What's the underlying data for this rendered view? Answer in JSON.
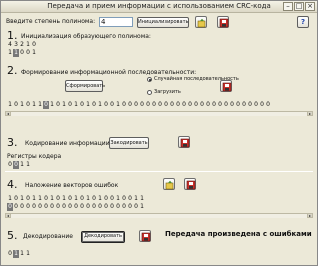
{
  "window": {
    "title": "Передача и прием информации с использованием CRC-кода"
  },
  "polynomial": {
    "label": "Введите степень полинома:",
    "value": "4",
    "init_button": "Инициализировать",
    "help_button": "?"
  },
  "section1": {
    "number": "1.",
    "title": "Инициализация образующего полинома:",
    "exponents": [
      "4",
      "3",
      "2",
      "1",
      "0"
    ],
    "coefficients": [
      "1",
      "1",
      "0",
      "0",
      "1"
    ],
    "selected_index": 1
  },
  "section2": {
    "number": "2.",
    "title": "Формирование информационной последовательности:",
    "generate_button": "Сформировать",
    "radio_random": "Случайная последовательность",
    "radio_load": "Загрузить",
    "bits": [
      "1",
      "0",
      "1",
      "0",
      "1",
      "1",
      "0",
      "1",
      "0",
      "1",
      "0",
      "1",
      "0",
      "1",
      "0",
      "1",
      "0",
      "0",
      "1",
      "0",
      "0",
      "0",
      "0",
      "0",
      "0",
      "0",
      "0",
      "0",
      "0",
      "0",
      "0",
      "0",
      "0",
      "0",
      "0",
      "0",
      "0",
      "0",
      "0",
      "0",
      "0",
      "0",
      "0",
      "0"
    ],
    "selected_index": 6
  },
  "section3": {
    "number": "3.",
    "title": "Кодирование информации",
    "encode_button": "Закодировать",
    "registers_label": "Регистры кодера",
    "registers": [
      "0",
      "0",
      "1",
      "1"
    ],
    "selected_index": 1
  },
  "section4": {
    "number": "4.",
    "title": "Наложение векторов ошибок",
    "row1": [
      "1",
      "0",
      "1",
      "0",
      "1",
      "1",
      "0",
      "1",
      "0",
      "1",
      "0",
      "1",
      "0",
      "1",
      "0",
      "1",
      "0",
      "0",
      "1",
      "0",
      "0",
      "1",
      "1"
    ],
    "row2": [
      "0",
      "0",
      "0",
      "0",
      "0",
      "0",
      "0",
      "0",
      "0",
      "0",
      "0",
      "0",
      "0",
      "0",
      "0",
      "0",
      "0",
      "0",
      "0",
      "0",
      "0",
      "0",
      "1"
    ],
    "row2_selected_index": 0
  },
  "section5": {
    "number": "5.",
    "title": "Декодирование",
    "decode_button": "Декодировать",
    "result": "Передача произведена с ошибками",
    "registers": [
      "0",
      "1",
      "1",
      "1"
    ],
    "selected_index": 1
  }
}
